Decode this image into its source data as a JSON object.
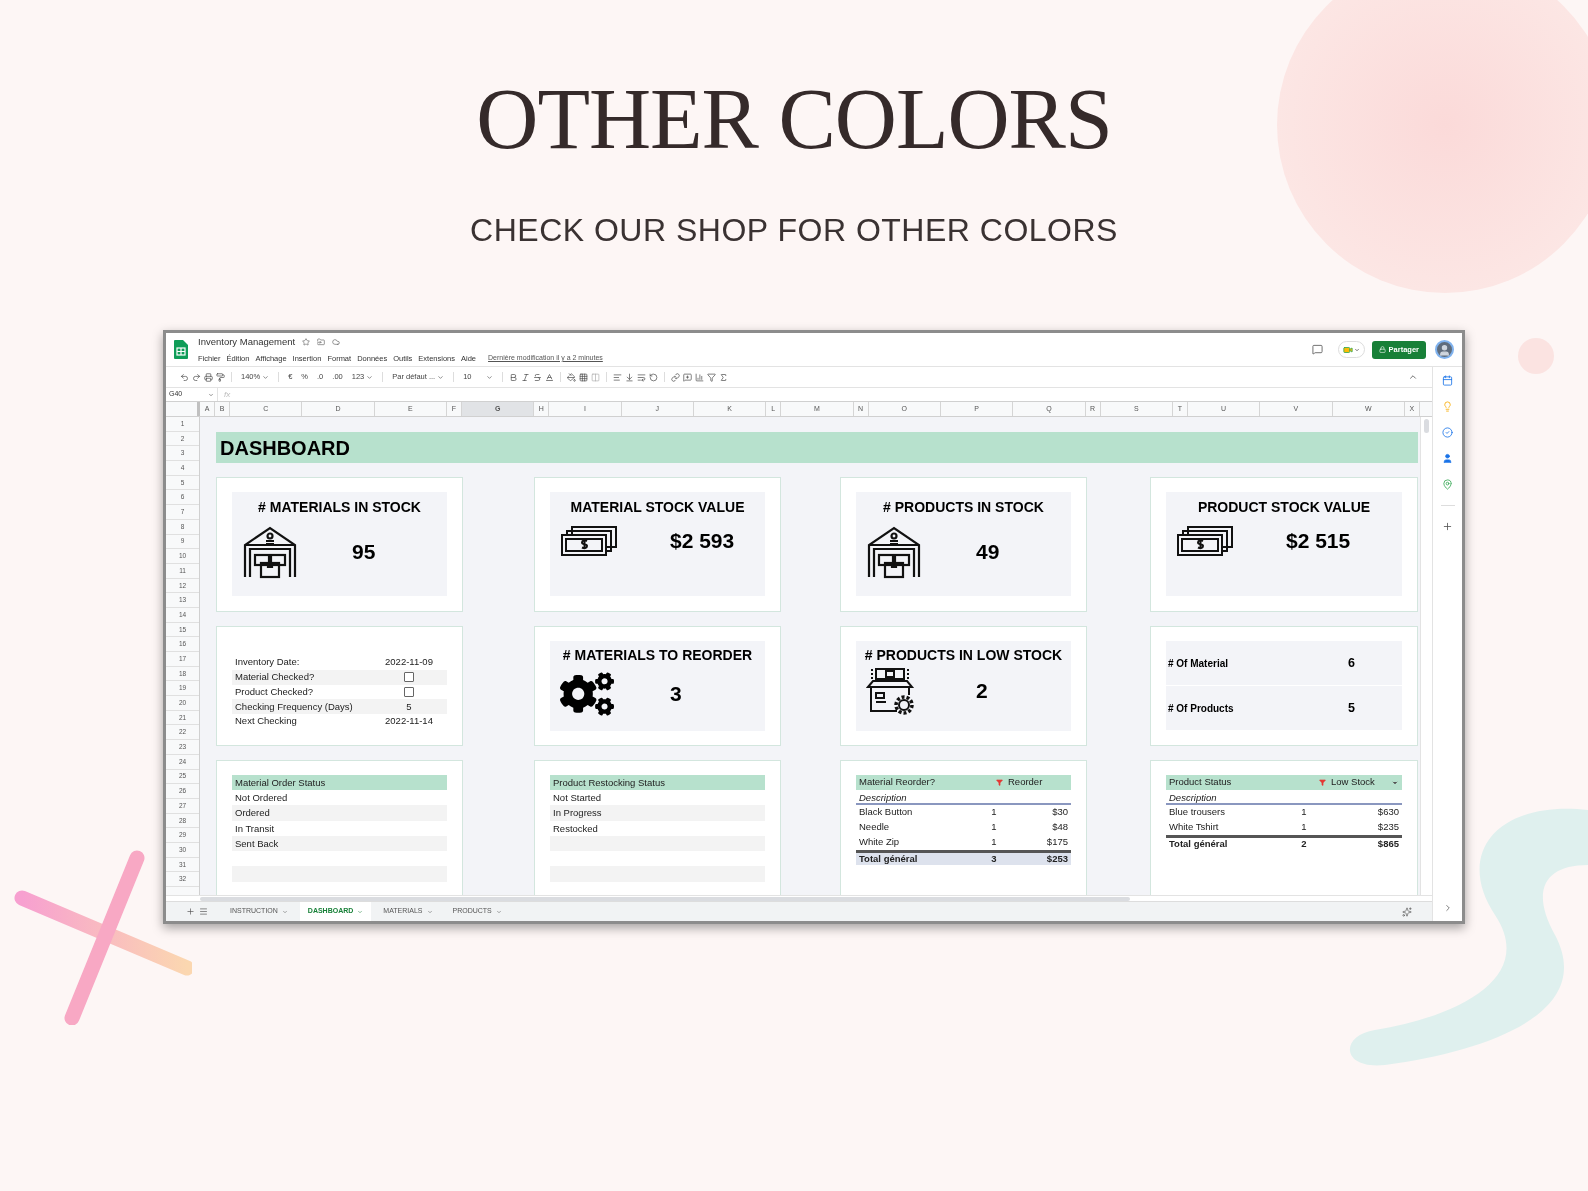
{
  "header": {
    "title": "OTHER COLORS",
    "subtitle": "CHECK OUR SHOP FOR OTHER COLORS"
  },
  "app": {
    "doc_title": "Inventory Management",
    "menu": [
      "Fichier",
      "Édition",
      "Affichage",
      "Insertion",
      "Format",
      "Données",
      "Outils",
      "Extensions",
      "Aide"
    ],
    "last_modified": "Dernière modification il y a 2 minutes",
    "share_button": "Partager",
    "toolbar": {
      "zoom": "140%",
      "currency": "€",
      "percent": "%",
      "decrease_decimals": ".0",
      "increase_decimals": ".00",
      "number_format": "123",
      "font": "Par défaut ...",
      "font_size": "10"
    },
    "name_box": "G40",
    "formula_label": "fx",
    "columns": [
      {
        "label": "A",
        "kind": "narrow",
        "selected": false
      },
      {
        "label": "B",
        "kind": "narrow",
        "selected": false
      },
      {
        "label": "C",
        "kind": "wide",
        "selected": false
      },
      {
        "label": "D",
        "kind": "wide",
        "selected": false
      },
      {
        "label": "E",
        "kind": "wide",
        "selected": false
      },
      {
        "label": "F",
        "kind": "narrow",
        "selected": false
      },
      {
        "label": "G",
        "kind": "wide",
        "selected": true
      },
      {
        "label": "H",
        "kind": "narrow",
        "selected": false
      },
      {
        "label": "I",
        "kind": "wide",
        "selected": false
      },
      {
        "label": "J",
        "kind": "wide",
        "selected": false
      },
      {
        "label": "K",
        "kind": "wide",
        "selected": false
      },
      {
        "label": "L",
        "kind": "narrow",
        "selected": false
      },
      {
        "label": "M",
        "kind": "wide",
        "selected": false
      },
      {
        "label": "N",
        "kind": "narrow",
        "selected": false
      },
      {
        "label": "O",
        "kind": "wide",
        "selected": false
      },
      {
        "label": "P",
        "kind": "wide",
        "selected": false
      },
      {
        "label": "Q",
        "kind": "wide",
        "selected": false
      },
      {
        "label": "R",
        "kind": "narrow",
        "selected": false
      },
      {
        "label": "S",
        "kind": "wide",
        "selected": false
      },
      {
        "label": "T",
        "kind": "narrow",
        "selected": false
      },
      {
        "label": "U",
        "kind": "wide",
        "selected": false
      },
      {
        "label": "V",
        "kind": "wide",
        "selected": false
      },
      {
        "label": "W",
        "kind": "wide",
        "selected": false
      },
      {
        "label": "X",
        "kind": "narrow",
        "selected": false
      }
    ],
    "rows": [
      "1",
      "2",
      "3",
      "4",
      "5",
      "6",
      "7",
      "8",
      "9",
      "10",
      "11",
      "12",
      "13",
      "14",
      "15",
      "16",
      "17",
      "18",
      "19",
      "20",
      "21",
      "22",
      "23",
      "24",
      "25",
      "26",
      "27",
      "28",
      "29",
      "30",
      "31",
      "32"
    ],
    "sheet_title": "DASHBOARD",
    "kpi_cards": [
      {
        "title": "# MATERIALS IN STOCK",
        "value": "95",
        "kind": "warehouse"
      },
      {
        "title": "MATERIAL STOCK VALUE",
        "value": "$2 593",
        "kind": "money"
      },
      {
        "title": "# PRODUCTS IN STOCK",
        "value": "49",
        "kind": "warehouse"
      },
      {
        "title": "PRODUCT STOCK VALUE",
        "value": "$2 515",
        "kind": "money"
      }
    ],
    "info_rows": [
      {
        "kind": "text",
        "label": "Inventory Date:",
        "value": "2022-11-09"
      },
      {
        "kind": "checkbox",
        "label": "Material Checked?",
        "checked": false
      },
      {
        "kind": "checkbox",
        "label": "Product Checked?",
        "checked": false
      },
      {
        "kind": "text",
        "label": "Checking Frequency (Days)",
        "value": "5"
      },
      {
        "kind": "text",
        "label": "Next Checking",
        "value": "2022-11-14"
      }
    ],
    "alert_cards": [
      {
        "title": "# MATERIALS TO REORDER",
        "value": "3",
        "kind": "gears"
      },
      {
        "title": "# PRODUCTS IN LOW STOCK",
        "value": "2",
        "kind": "box"
      }
    ],
    "counts": [
      {
        "label": "# Of Material",
        "value": "6"
      },
      {
        "label": "# Of Products",
        "value": "5"
      }
    ],
    "status_lists": [
      {
        "heading": "Material Order Status",
        "items": [
          "Not Ordered",
          "Ordered",
          "In Transit",
          "Sent Back"
        ]
      },
      {
        "heading": "Product Restocking Status",
        "items": [
          "Not Started",
          "In Progress",
          "Restocked"
        ]
      }
    ],
    "pivot_tables": [
      {
        "filter_label": "Material Reorder?",
        "filter_value": "Reorder",
        "has_dropdown": false,
        "subheading": "Description",
        "rows": [
          {
            "name": "Black Button",
            "count": "1",
            "amount": "$30"
          },
          {
            "name": "Needle",
            "count": "1",
            "amount": "$48"
          },
          {
            "name": "White Zip",
            "count": "1",
            "amount": "$175"
          }
        ],
        "total": {
          "label": "Total général",
          "count": "3",
          "amount": "$253",
          "shaded": true
        }
      },
      {
        "filter_label": "Product Status",
        "filter_value": "Low Stock",
        "has_dropdown": true,
        "subheading": "Description",
        "rows": [
          {
            "name": "Blue trousers",
            "count": "1",
            "amount": "$630"
          },
          {
            "name": "White Tshirt",
            "count": "1",
            "amount": "$235"
          }
        ],
        "total": {
          "label": "Total général",
          "count": "2",
          "amount": "$865",
          "shaded": false
        }
      }
    ],
    "sheet_tabs": [
      {
        "label": "INSTRUCTION",
        "selected": false
      },
      {
        "label": "DASHBOARD",
        "selected": true
      },
      {
        "label": "MATERIALS",
        "selected": false
      },
      {
        "label": "PRODUCTS",
        "selected": false
      }
    ]
  }
}
